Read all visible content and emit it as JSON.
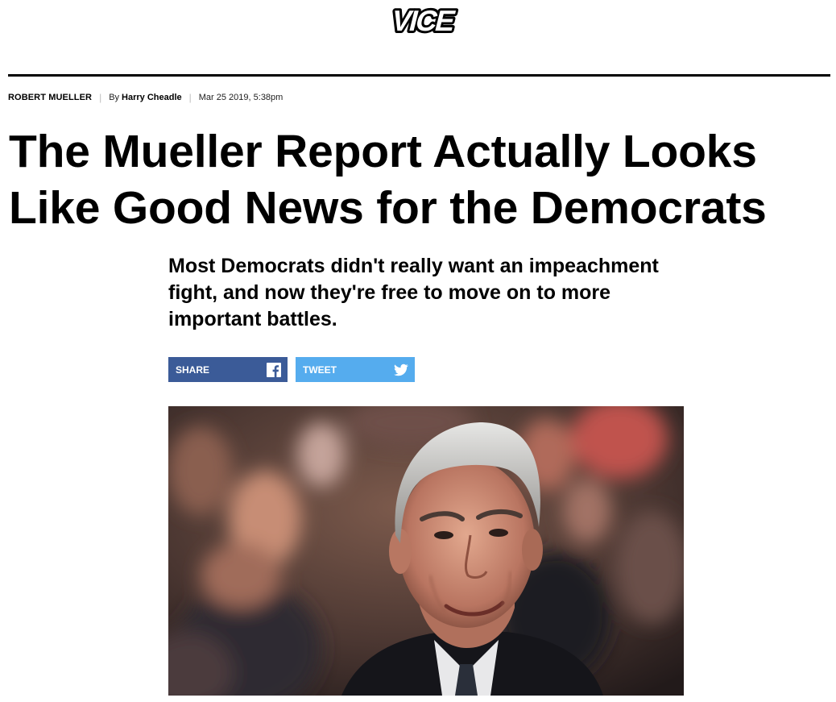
{
  "header": {
    "logo_text": "VICE"
  },
  "article": {
    "topic": "ROBERT MUELLER",
    "byline_prefix": "By",
    "author": "Harry Cheadle",
    "date": "Mar 25 2019, 5:38pm",
    "headline": "The Mueller Report Actually Looks Like Good News for the Democrats",
    "dek": "Most Democrats didn't really want an impeachment fight, and now they're free to move on to more important battles."
  },
  "share": {
    "facebook_label": "SHARE",
    "twitter_label": "TWEET",
    "facebook_icon": "facebook-icon",
    "twitter_icon": "twitter-icon"
  },
  "colors": {
    "facebook": "#3b5b98",
    "twitter": "#55acee",
    "rule": "#000000"
  }
}
